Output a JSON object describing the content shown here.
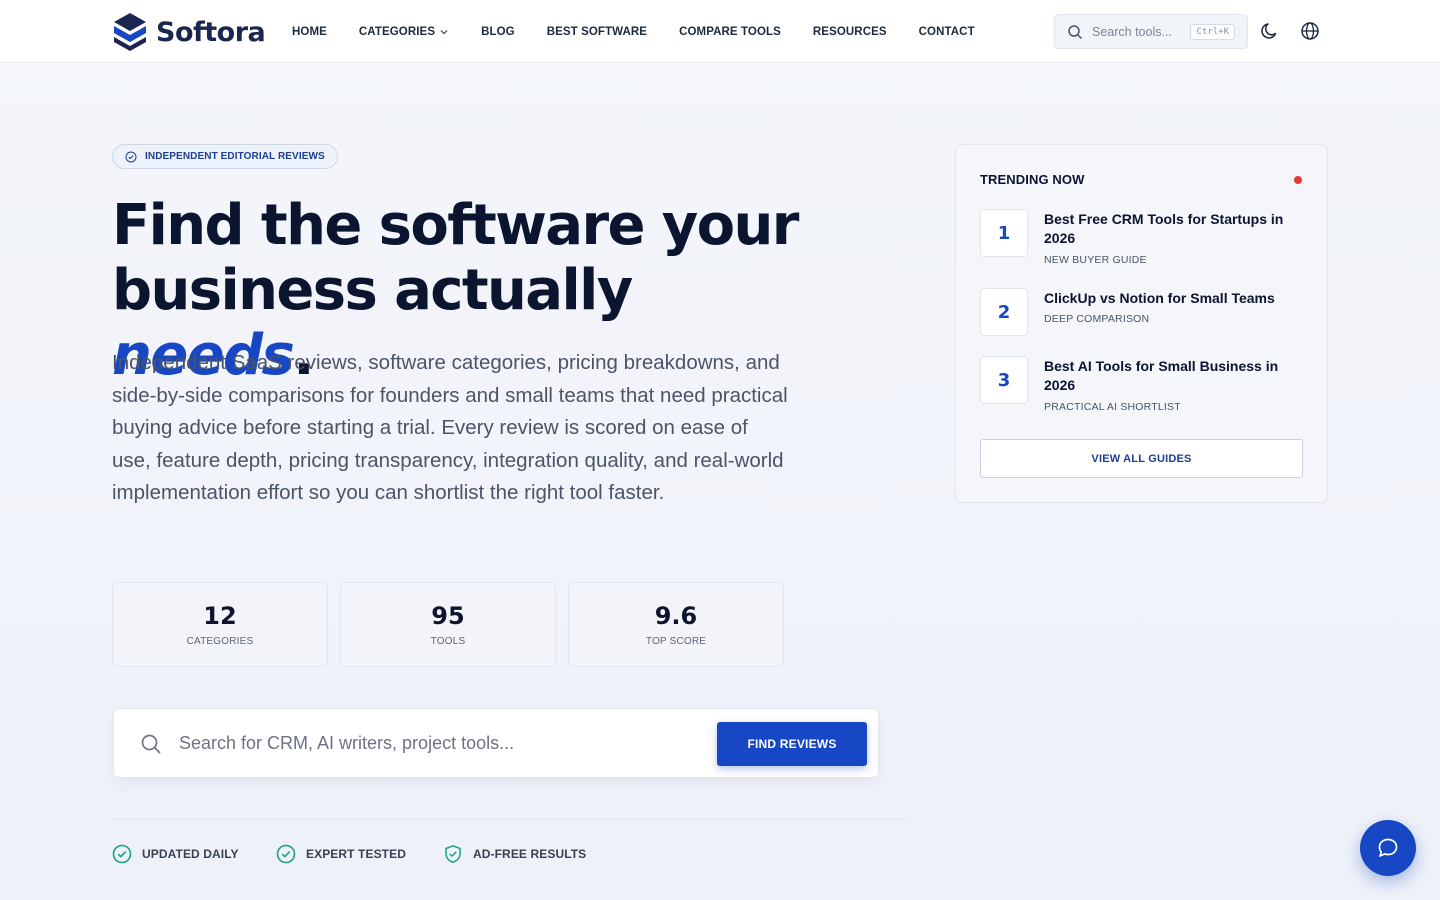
{
  "brand": {
    "name": "Softora"
  },
  "nav": {
    "items": [
      {
        "label": "HOME"
      },
      {
        "label": "CATEGORIES"
      },
      {
        "label": "BLOG"
      },
      {
        "label": "BEST SOFTWARE"
      },
      {
        "label": "COMPARE TOOLS"
      },
      {
        "label": "RESOURCES"
      },
      {
        "label": "CONTACT"
      }
    ]
  },
  "header_search": {
    "placeholder": "Search tools...",
    "shortcut": "Ctrl+K"
  },
  "icons": {
    "theme": "moon-icon",
    "language": "globe-icon",
    "search": "search-icon",
    "chat": "chat-bubble-icon"
  },
  "hero": {
    "badge": "INDEPENDENT EDITORIAL REVIEWS",
    "title_line1": "Find the software your",
    "title_line2": "business actually",
    "title_accent": "needs",
    "title_end": ".",
    "description": "Independent SaaS reviews, software categories, pricing breakdowns, and side-by-side comparisons for founders and small teams that need practical buying advice before starting a trial. Every review is scored on ease of use, feature depth, pricing transparency, integration quality, and real-world implementation effort so you can shortlist the right tool faster."
  },
  "stats": [
    {
      "value": "12",
      "label": "CATEGORIES"
    },
    {
      "value": "95",
      "label": "TOOLS"
    },
    {
      "value": "9.6",
      "label": "TOP SCORE"
    }
  ],
  "main_search": {
    "placeholder": "Search for CRM, AI writers, project tools...",
    "button": "FIND REVIEWS"
  },
  "features": [
    {
      "label": "UPDATED DAILY"
    },
    {
      "label": "EXPERT TESTED"
    },
    {
      "label": "AD-FREE RESULTS"
    }
  ],
  "trending": {
    "heading": "TRENDING NOW",
    "items": [
      {
        "rank": "1",
        "title": "Best Free CRM Tools for Startups in 2026",
        "tag": "NEW BUYER GUIDE"
      },
      {
        "rank": "2",
        "title": "ClickUp vs Notion for Small Teams",
        "tag": "DEEP COMPARISON"
      },
      {
        "rank": "3",
        "title": "Best AI Tools for Small Business in 2026",
        "tag": "PRACTICAL AI SHORTLIST"
      }
    ],
    "button": "VIEW ALL GUIDES"
  },
  "colors": {
    "accent": "#1747c4",
    "brand_dark": "#1b2650",
    "live": "#e53935",
    "check": "#1aa57a"
  }
}
